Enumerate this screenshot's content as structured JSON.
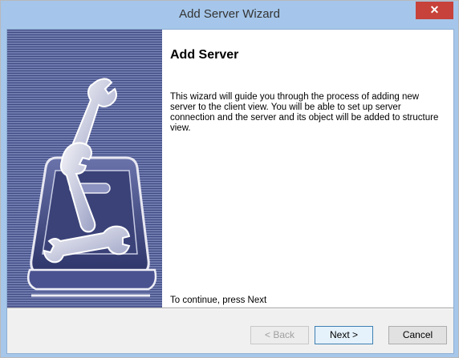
{
  "window": {
    "title": "Add Server Wizard",
    "close_glyph": "✕"
  },
  "content": {
    "heading": "Add Server",
    "description": "This wizard will guide you through the process of adding new server to the client view. You will be able to set up server connection and the server and its object will be added to structure view.",
    "continue_hint": "To continue, press Next"
  },
  "buttons": {
    "back": "< Back",
    "next": "Next >",
    "cancel": "Cancel"
  },
  "icons": {
    "banner": "toolbox-wrenches-icon",
    "close": "close-icon"
  },
  "colors": {
    "titlebar": "#a5c6ea",
    "close": "#c7423a",
    "banner": "#5a659c"
  }
}
